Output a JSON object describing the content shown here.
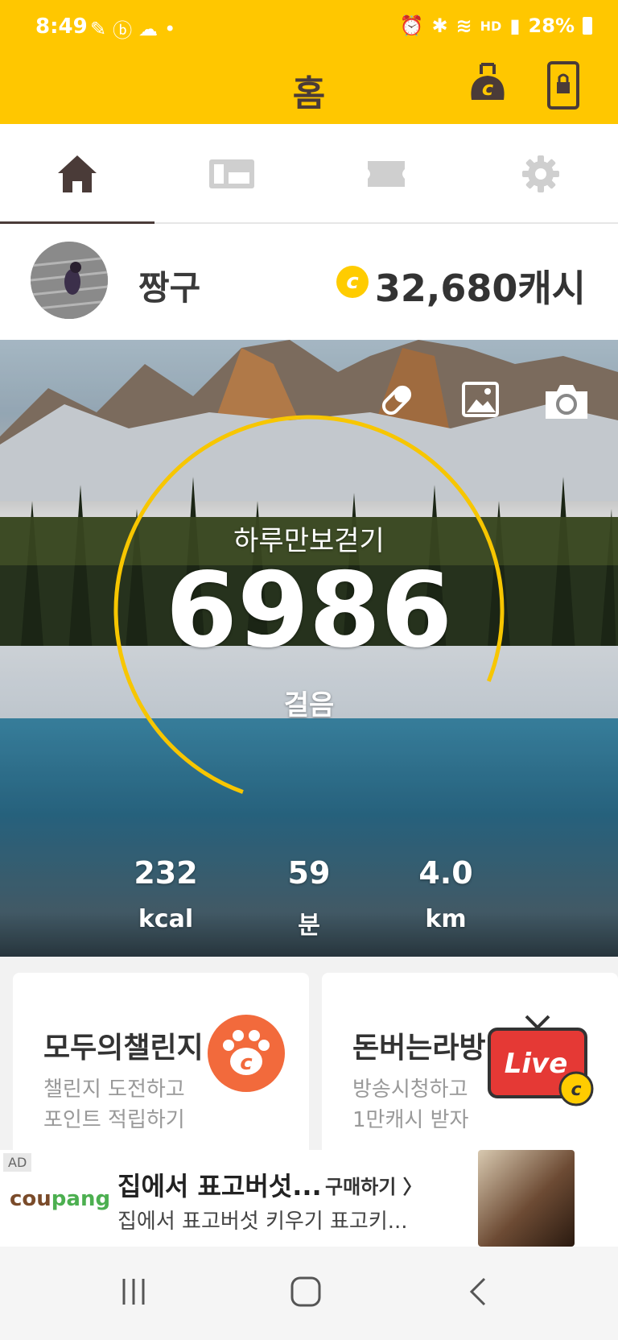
{
  "status_bar": {
    "time": "8:49",
    "battery": "28%",
    "net": "HD"
  },
  "app_bar": {
    "title": "홈",
    "icons": [
      "cash-bag-icon",
      "phone-lock-icon"
    ]
  },
  "tabs": [
    {
      "name": "home",
      "icon": "home-icon",
      "active": true
    },
    {
      "name": "gift",
      "icon": "gift-card-icon",
      "active": false
    },
    {
      "name": "ticket",
      "icon": "ticket-icon",
      "active": false
    },
    {
      "name": "settings",
      "icon": "gear-icon",
      "active": false
    }
  ],
  "profile": {
    "username": "짱구",
    "coin_symbol": "c",
    "cash": "32,680캐시"
  },
  "hero": {
    "goal_title": "하루만보걷기",
    "steps": "6986",
    "steps_unit": "걸음",
    "progress_ratio": 0.6986,
    "icons": [
      "pill-icon",
      "image-icon",
      "camera-icon"
    ],
    "stats": [
      {
        "value": "232",
        "unit": "kcal"
      },
      {
        "value": "59",
        "unit": "분"
      },
      {
        "value": "4.0",
        "unit": "km"
      }
    ]
  },
  "cards": [
    {
      "title": "모두의챌린지",
      "sub1": "챌린지 도전하고",
      "sub2": "포인트 적립하기"
    },
    {
      "title": "돈버는라방",
      "sub1": "방송시청하고",
      "sub2": "1만캐시 받자",
      "badge": "Live"
    }
  ],
  "ad": {
    "tag": "AD",
    "brand_part1": "cou",
    "brand_part2": "pang",
    "title": "집에서 표고버섯...",
    "cta": "구매하기 〉",
    "description": "집에서 표고버섯 키우기 표고키..."
  },
  "colors": {
    "accent": "#ffc700",
    "dark": "#4a3b38",
    "ring": "#f7c600"
  }
}
